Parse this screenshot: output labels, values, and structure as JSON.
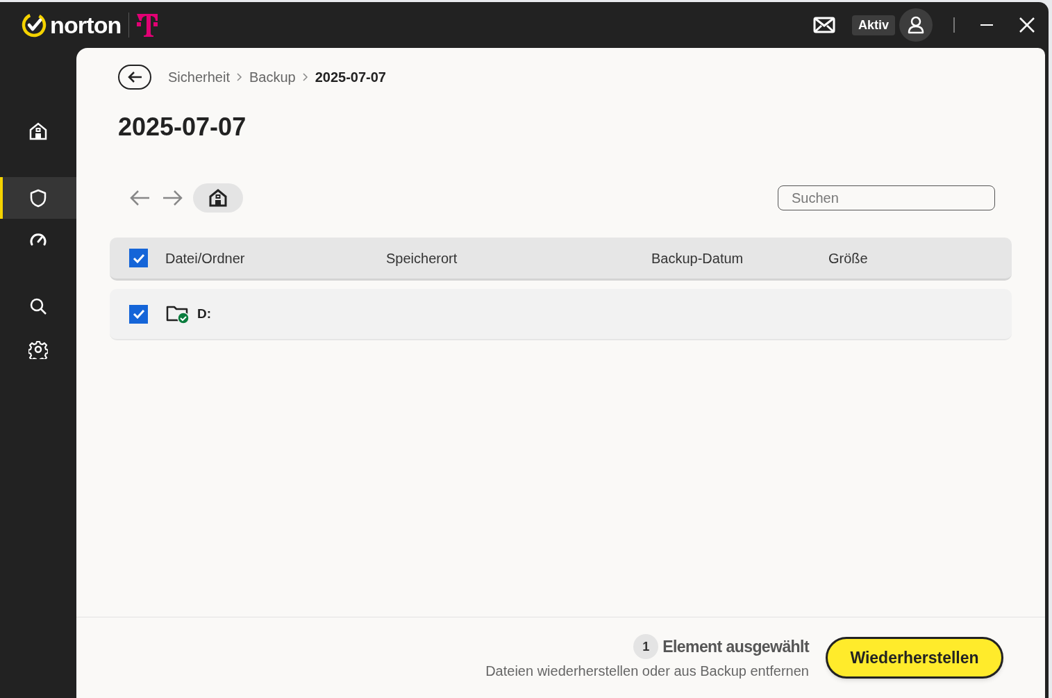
{
  "header": {
    "brand": "norton",
    "status_badge": "Aktiv"
  },
  "sidebar": {
    "items": [
      {
        "kind": "home",
        "selected": false
      },
      {
        "kind": "shield",
        "selected": true
      },
      {
        "kind": "gauge",
        "selected": false
      },
      {
        "kind": "search",
        "selected": false
      },
      {
        "kind": "gear",
        "selected": false
      }
    ]
  },
  "breadcrumb": [
    "Sicherheit",
    "Backup",
    "2025-07-07"
  ],
  "page_title": "2025-07-07",
  "search": {
    "placeholder": "Suchen"
  },
  "table": {
    "select_all_checked": true,
    "columns": [
      "Datei/Ordner",
      "Speicherort",
      "Backup-Datum",
      "Größe"
    ],
    "rows": [
      {
        "name": "D:",
        "checked": true
      }
    ]
  },
  "footer": {
    "count": "1",
    "selection_label": "Element ausgewählt",
    "hint": "Dateien wiederherstellen oder aus Backup entfernen",
    "button": "Wiederherstellen"
  }
}
